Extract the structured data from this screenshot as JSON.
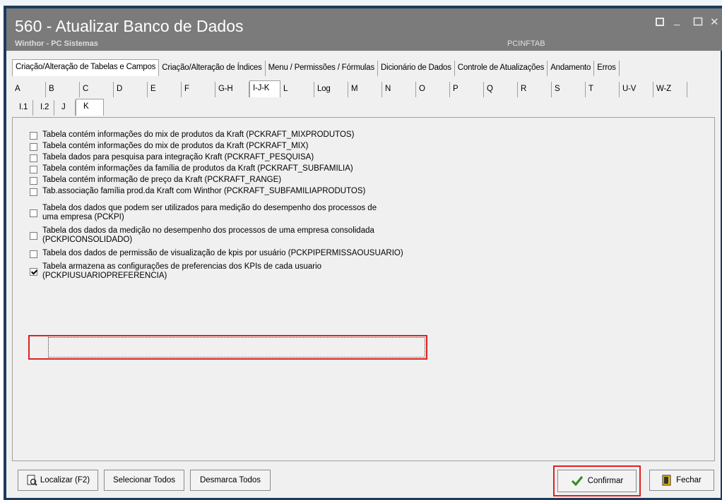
{
  "window": {
    "title": "560 - Atualizar Banco de Dados",
    "subtitle": "Winthor - PC Sistemas",
    "db_name": "PCINFTAB",
    "controls": [
      "restore-icon",
      "minimize-icon",
      "maximize-icon",
      "close-icon"
    ]
  },
  "main_tabs": [
    {
      "label": "Criação/Alteração de Tabelas e Campos",
      "active": true
    },
    {
      "label": "Criação/Alteração de Índices"
    },
    {
      "label": "Menu / Permissões / Fórmulas"
    },
    {
      "label": "Dicionário de Dados"
    },
    {
      "label": "Controle de Atualizações"
    },
    {
      "label": "Andamento"
    },
    {
      "label": "Erros"
    }
  ],
  "letter_tabs": [
    {
      "label": "A"
    },
    {
      "label": "B"
    },
    {
      "label": "C"
    },
    {
      "label": "D"
    },
    {
      "label": "E"
    },
    {
      "label": "F"
    },
    {
      "label": "G-H"
    },
    {
      "label": "I-J-K",
      "active": true
    },
    {
      "label": "L"
    },
    {
      "label": "Log"
    },
    {
      "label": "M"
    },
    {
      "label": "N"
    },
    {
      "label": "O"
    },
    {
      "label": "P"
    },
    {
      "label": "Q"
    },
    {
      "label": "R"
    },
    {
      "label": "S"
    },
    {
      "label": "T"
    },
    {
      "label": "U-V"
    },
    {
      "label": "W-Z"
    }
  ],
  "sub_tabs": [
    {
      "label": "I.1"
    },
    {
      "label": "I.2"
    },
    {
      "label": "J"
    },
    {
      "label": "K",
      "active": true
    }
  ],
  "checkboxes": [
    {
      "label": "Tabela contém informações do mix de produtos da Kraft (PCKRAFT_MIXPRODUTOS)",
      "checked": false
    },
    {
      "label": "Tabela contém informações do mix de produtos da Kraft (PCKRAFT_MIX)",
      "checked": false
    },
    {
      "label": "Tabela dados para pesquisa para integração Kraft (PCKRAFT_PESQUISA)",
      "checked": false
    },
    {
      "label": "Tabela contém informações da família de produtos da Kraft (PCKRAFT_SUBFAMILIA)",
      "checked": false
    },
    {
      "label": "Tabela contém informação de preço da Kraft (PCKRAFT_RANGE)",
      "checked": false
    },
    {
      "label": "Tab.associação família prod.da Kraft com Winthor (PCKRAFT_SUBFAMILIAPRODUTOS)",
      "checked": false
    },
    {
      "label": "Tabela dos dados que podem ser utilizados para medição do desempenho dos processos de\numa empresa (PCKPI)",
      "checked": false
    },
    {
      "label": "Tabela dos dados da medição no desempenho dos processos de uma empresa consolidada\n(PCKPICONSOLIDADO)",
      "checked": false
    },
    {
      "label": "Tabela dos dados de permissão de visualização de kpis por usuário (PCKPIPERMISSAOUSUARIO)",
      "checked": false
    },
    {
      "label": "Tabela armazena as configurações de preferencias dos KPIs de cada usuario\n(PCKPIUSUARIOPREFERENCIA)",
      "checked": true
    }
  ],
  "buttons": {
    "localizar": "Localizar (F2)",
    "selecionar_todos": "Selecionar Todos",
    "desmarca_todos": "Desmarca Todos",
    "confirmar": "Confirmar",
    "fechar": "Fechar"
  },
  "colors": {
    "highlight": "#e02020",
    "confirm_check": "#2e8b1a"
  }
}
